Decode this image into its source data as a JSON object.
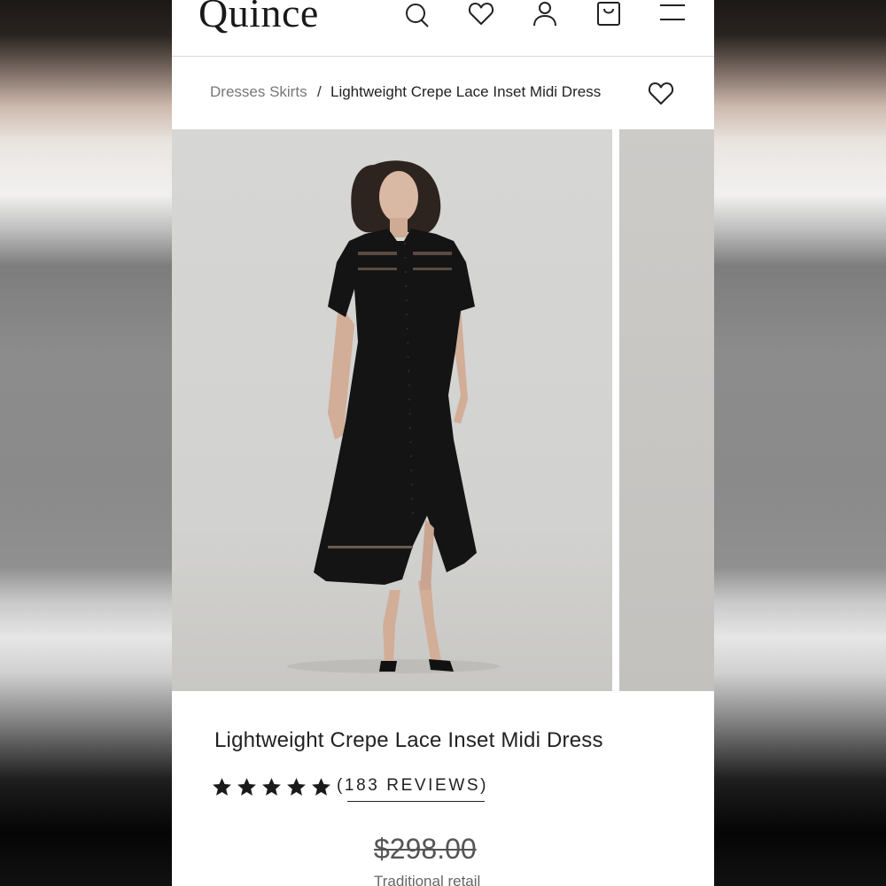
{
  "header": {
    "logo": "Quince",
    "icons": [
      "search-icon",
      "heart-icon",
      "account-icon",
      "cart-icon",
      "menu-icon"
    ]
  },
  "breadcrumb": {
    "parent": "Dresses Skirts",
    "separator": "/",
    "current": "Lightweight Crepe Lace Inset Midi Dress"
  },
  "product": {
    "title": "Lightweight Crepe Lace Inset Midi Dress",
    "rating": 5,
    "reviews_label": "(183 REVIEWS)",
    "compare_price": "$298.00",
    "compare_label": "Traditional retail"
  },
  "colors": {
    "text": "#222222",
    "muted": "#777777",
    "dress": "#141414"
  }
}
